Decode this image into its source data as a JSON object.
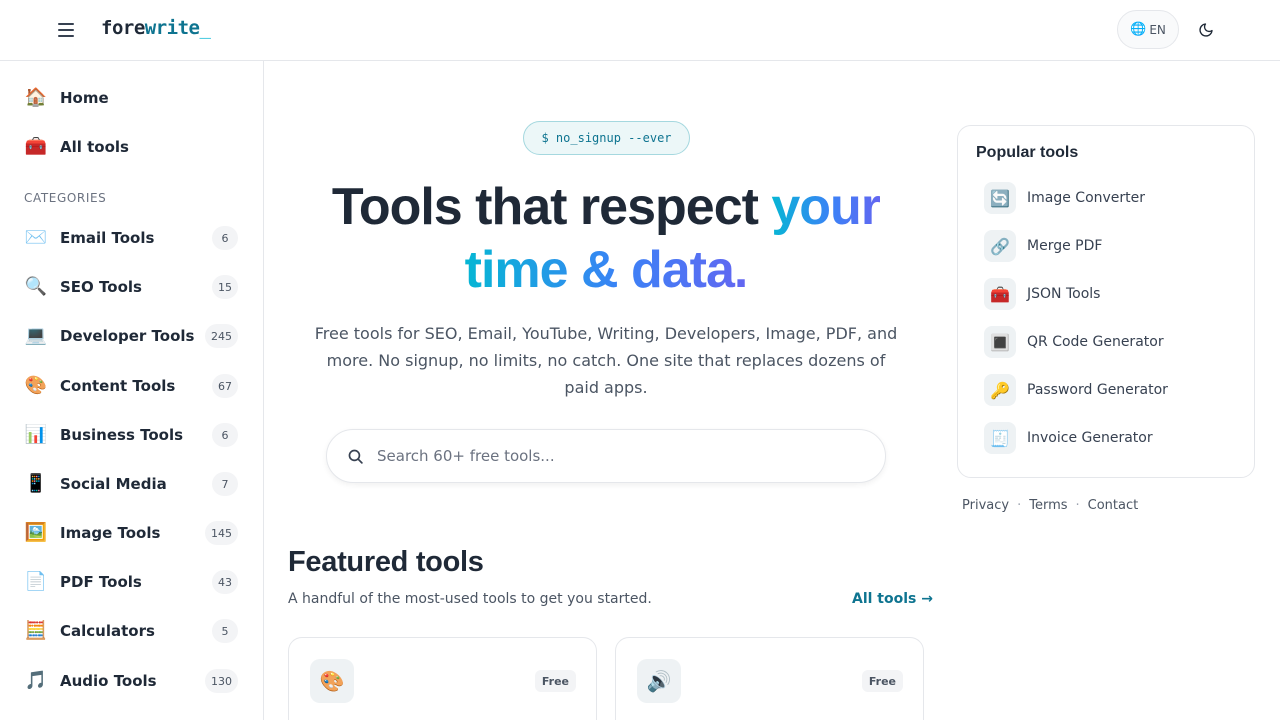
{
  "header": {
    "logo_part1": "fore",
    "logo_part2": "write",
    "logo_part3": "_",
    "lang_label": "EN",
    "lang_icon": "🌐",
    "menu_icon": "hamburger-icon",
    "theme_icon": "moon-icon"
  },
  "sidebar": {
    "top": [
      {
        "icon": "🏠",
        "label": "Home"
      },
      {
        "icon": "🧰",
        "label": "All tools"
      }
    ],
    "category_heading": "CATEGORIES",
    "categories": [
      {
        "icon": "✉️",
        "label": "Email Tools",
        "count": "6"
      },
      {
        "icon": "🔍",
        "label": "SEO Tools",
        "count": "15"
      },
      {
        "icon": "💻",
        "label": "Developer Tools",
        "count": "245"
      },
      {
        "icon": "🎨",
        "label": "Content Tools",
        "count": "67"
      },
      {
        "icon": "📊",
        "label": "Business Tools",
        "count": "6"
      },
      {
        "icon": "📱",
        "label": "Social Media",
        "count": "7"
      },
      {
        "icon": "🖼️",
        "label": "Image Tools",
        "count": "145"
      },
      {
        "icon": "📄",
        "label": "PDF Tools",
        "count": "43"
      },
      {
        "icon": "🧮",
        "label": "Calculators",
        "count": "5"
      },
      {
        "icon": "🎵",
        "label": "Audio Tools",
        "count": "130"
      }
    ]
  },
  "main": {
    "badge": "$ no_signup --ever",
    "hero_plain": "Tools that respect ",
    "hero_grad1": "your",
    "hero_grad2": "time & data.",
    "subtitle": "Free tools for SEO, Email, YouTube, Writing, Developers, Image, PDF, and more. No signup, no limits, no catch. One site that replaces dozens of paid apps.",
    "search_placeholder": "Search 60+ free tools...",
    "featured_title": "Featured tools",
    "featured_sub": "A handful of the most-used tools to get you started.",
    "featured_link": "All tools →",
    "cards": [
      {
        "icon": "🎨",
        "tag": "Free"
      },
      {
        "icon": "🔊",
        "tag": "Free"
      }
    ]
  },
  "popular": {
    "title": "Popular tools",
    "items": [
      {
        "icon": "🔄",
        "label": "Image Converter"
      },
      {
        "icon": "🔗",
        "label": "Merge PDF"
      },
      {
        "icon": "🧰",
        "label": "JSON Tools"
      },
      {
        "icon": "🔳",
        "label": "QR Code Generator"
      },
      {
        "icon": "🔑",
        "label": "Password Generator"
      },
      {
        "icon": "🧾",
        "label": "Invoice Generator"
      }
    ]
  },
  "footer": {
    "privacy": "Privacy",
    "terms": "Terms",
    "contact": "Contact",
    "separator": "·"
  }
}
